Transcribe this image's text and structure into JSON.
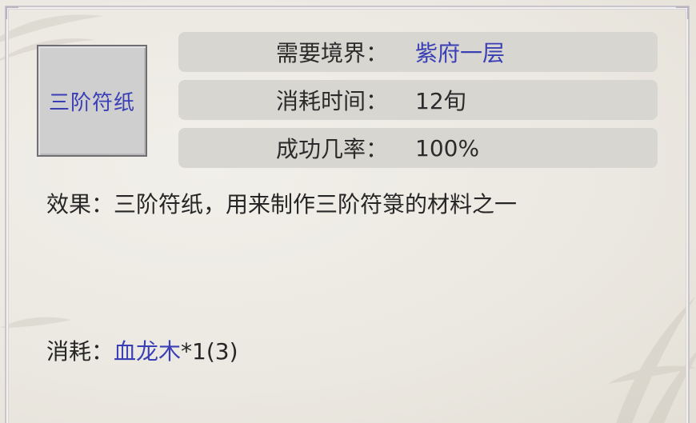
{
  "item": {
    "name": "三阶符纸"
  },
  "info": [
    {
      "label": "需要境界：",
      "value": "紫府一层",
      "value_color": "#3a3fb5"
    },
    {
      "label": "消耗时间：",
      "value": "12旬"
    },
    {
      "label": "成功几率：",
      "value": "100%"
    }
  ],
  "effect": {
    "label": "效果：",
    "text": "三阶符纸，用来制作三阶符箓的材料之一"
  },
  "cost": {
    "label": "消耗：",
    "material": "血龙木",
    "quantity": "*1(3)"
  },
  "colors": {
    "link": "#3a3fb5",
    "row_bg": "#d8d6d1",
    "panel_bg": "#ebe8e1"
  }
}
